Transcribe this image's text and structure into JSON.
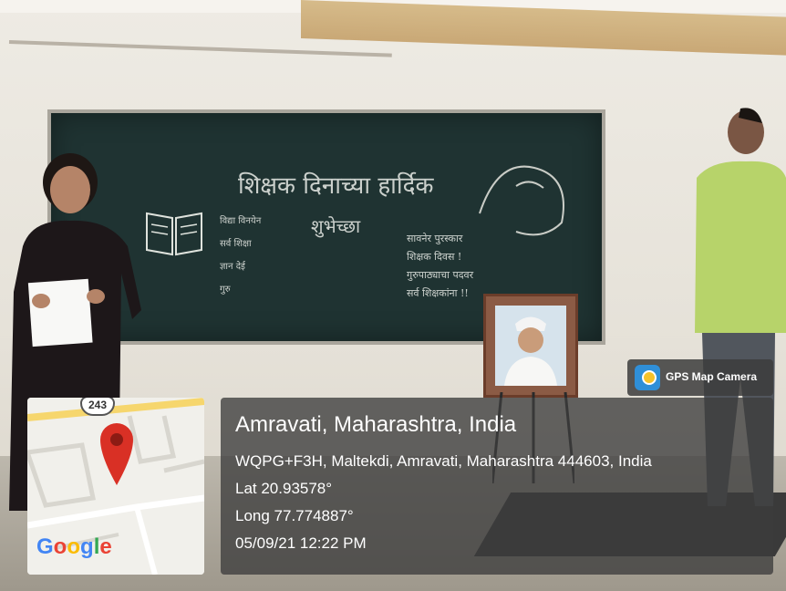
{
  "board": {
    "heading": "शिक्षक दिनाच्या हार्दिक",
    "subheading": "शुभेच्छा",
    "left_lines": [
      "विद्या विनयेन",
      "सर्व शिक्षा",
      "ज्ञान देई",
      "गुरु"
    ],
    "right_lines": [
      "सावनेर पुरस्कार",
      "शिक्षक दिवस !",
      "गुरुपाठ्याचा पदवर",
      "सर्व शिक्षकांना !!"
    ]
  },
  "overlay": {
    "app_badge": "GPS Map Camera",
    "place_title": "Amravati, Maharashtra, India",
    "address": "WQPG+F3H, Maltekdi, Amravati, Maharashtra 444603, India",
    "latitude": "Lat 20.93578°",
    "longitude": "Long 77.774887°",
    "datetime": "05/09/21 12:22 PM"
  },
  "map": {
    "road_number": "243",
    "brand": "Google",
    "brand_colors": [
      "#4285F4",
      "#EA4335",
      "#FBBC05",
      "#4285F4",
      "#34A853",
      "#EA4335"
    ],
    "pin_color": "#D93025",
    "pin_icon": "location-pin-icon"
  }
}
